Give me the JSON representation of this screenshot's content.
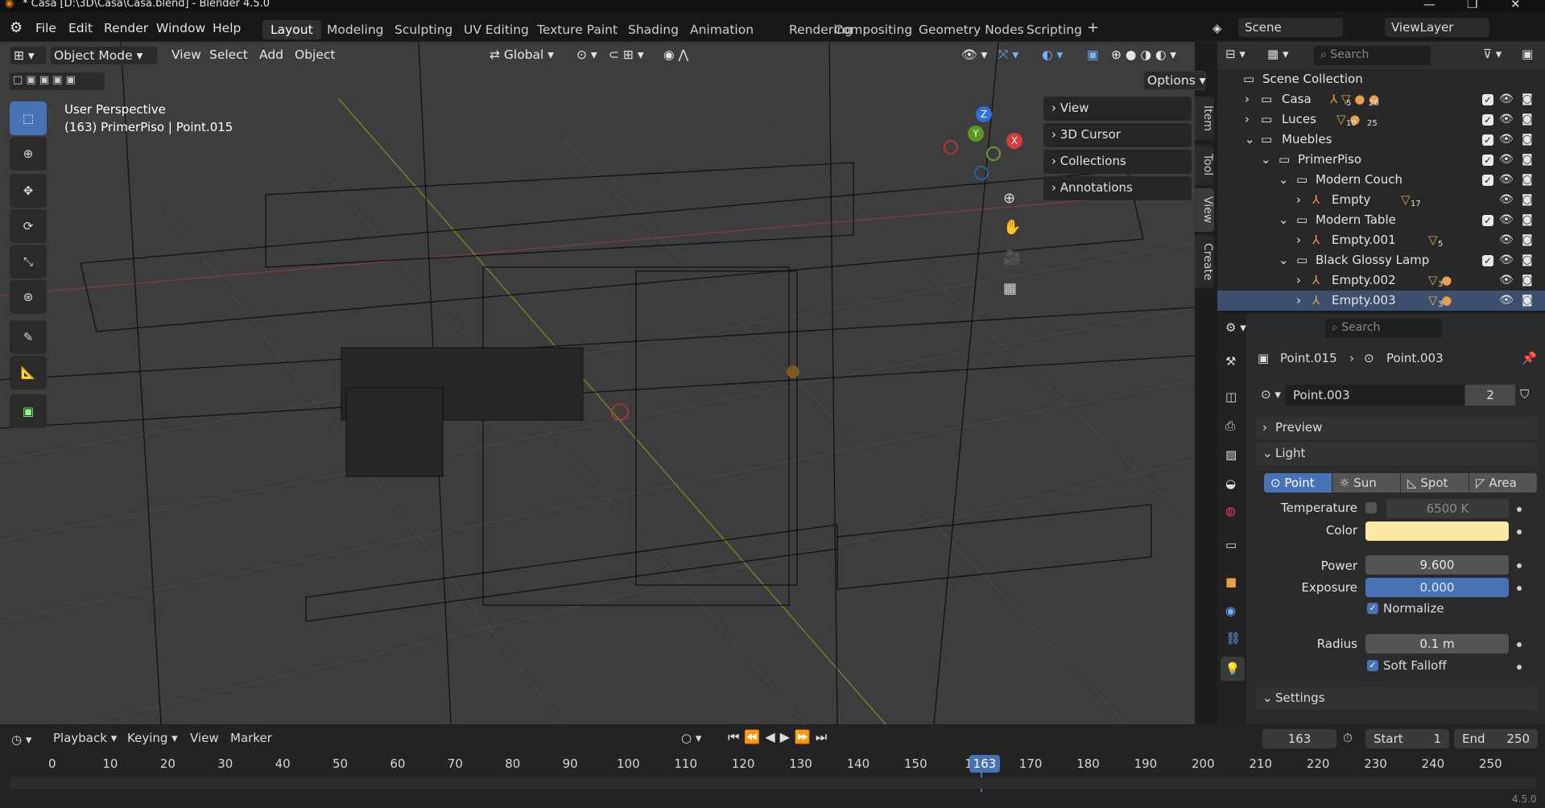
{
  "window": {
    "title": "* Casa [D:\\3D\\Casa\\Casa.blend] - Blender 4.5.0"
  },
  "menu": [
    "File",
    "Edit",
    "Render",
    "Window",
    "Help"
  ],
  "workspaces": [
    "Layout",
    "Modeling",
    "Sculpting",
    "UV Editing",
    "Texture Paint",
    "Shading",
    "Animation",
    "Rendering",
    "Compositing",
    "Geometry Nodes",
    "Scripting"
  ],
  "top_right": {
    "scene": "Scene",
    "view_layer": "ViewLayer"
  },
  "viewport": {
    "mode": "Object Mode",
    "menus": [
      "View",
      "Select",
      "Add",
      "Object"
    ],
    "orientation": "Global",
    "options": "Options",
    "overlay_line1": "User Perspective",
    "overlay_line2": "(163) PrimerPiso | Point.015",
    "npanel": [
      "View",
      "3D Cursor",
      "Collections",
      "Annotations"
    ],
    "side_tabs": [
      "Item",
      "Tool",
      "View",
      "Create"
    ],
    "gizmo": {
      "x": "X",
      "y": "Y",
      "z": "Z"
    }
  },
  "outliner": {
    "search_placeholder": "Search",
    "root": "Scene Collection",
    "rows": [
      {
        "label": "Casa",
        "badges": [
          "5",
          "26"
        ]
      },
      {
        "label": "Luces",
        "badges": [
          "10",
          "25"
        ]
      },
      {
        "label": "Muebles",
        "badges": []
      },
      {
        "label": "PrimerPiso",
        "badges": []
      },
      {
        "label": "Modern Couch",
        "badges": []
      },
      {
        "label": "Empty",
        "badges": [
          "17"
        ]
      },
      {
        "label": "Modern Table",
        "badges": []
      },
      {
        "label": "Empty.001",
        "badges": [
          "5"
        ]
      },
      {
        "label": "Black Glossy Lamp",
        "badges": []
      },
      {
        "label": "Empty.002",
        "badges": [
          "3"
        ]
      },
      {
        "label": "Empty.003",
        "badges": [
          "3"
        ]
      }
    ]
  },
  "properties": {
    "search_placeholder": "Search",
    "breadcrumb_object": "Point.015",
    "breadcrumb_data": "Point.003",
    "datablock": "Point.003",
    "users": "2",
    "preview": "Preview",
    "light": "Light",
    "light_types": [
      "Point",
      "Sun",
      "Spot",
      "Area"
    ],
    "temperature_label": "Temperature",
    "temperature": "6500 K",
    "color_label": "Color",
    "color": "#fbe9a6",
    "power_label": "Power",
    "power": "9.600",
    "exposure_label": "Exposure",
    "exposure": "0.000",
    "normalize": "Normalize",
    "radius_label": "Radius",
    "radius": "0.1 m",
    "soft_falloff": "Soft Falloff",
    "settings": "Settings"
  },
  "timeline": {
    "menus": [
      "Playback",
      "Keying",
      "View",
      "Marker"
    ],
    "current_frame": "163",
    "start_label": "Start",
    "start": "1",
    "end_label": "End",
    "end": "250",
    "ticks": [
      "0",
      "10",
      "20",
      "30",
      "40",
      "50",
      "60",
      "70",
      "80",
      "90",
      "100",
      "110",
      "120",
      "130",
      "140",
      "150",
      "16",
      "170",
      "180",
      "190",
      "200",
      "210",
      "220",
      "230",
      "240",
      "250"
    ],
    "version": "4.5.0"
  }
}
